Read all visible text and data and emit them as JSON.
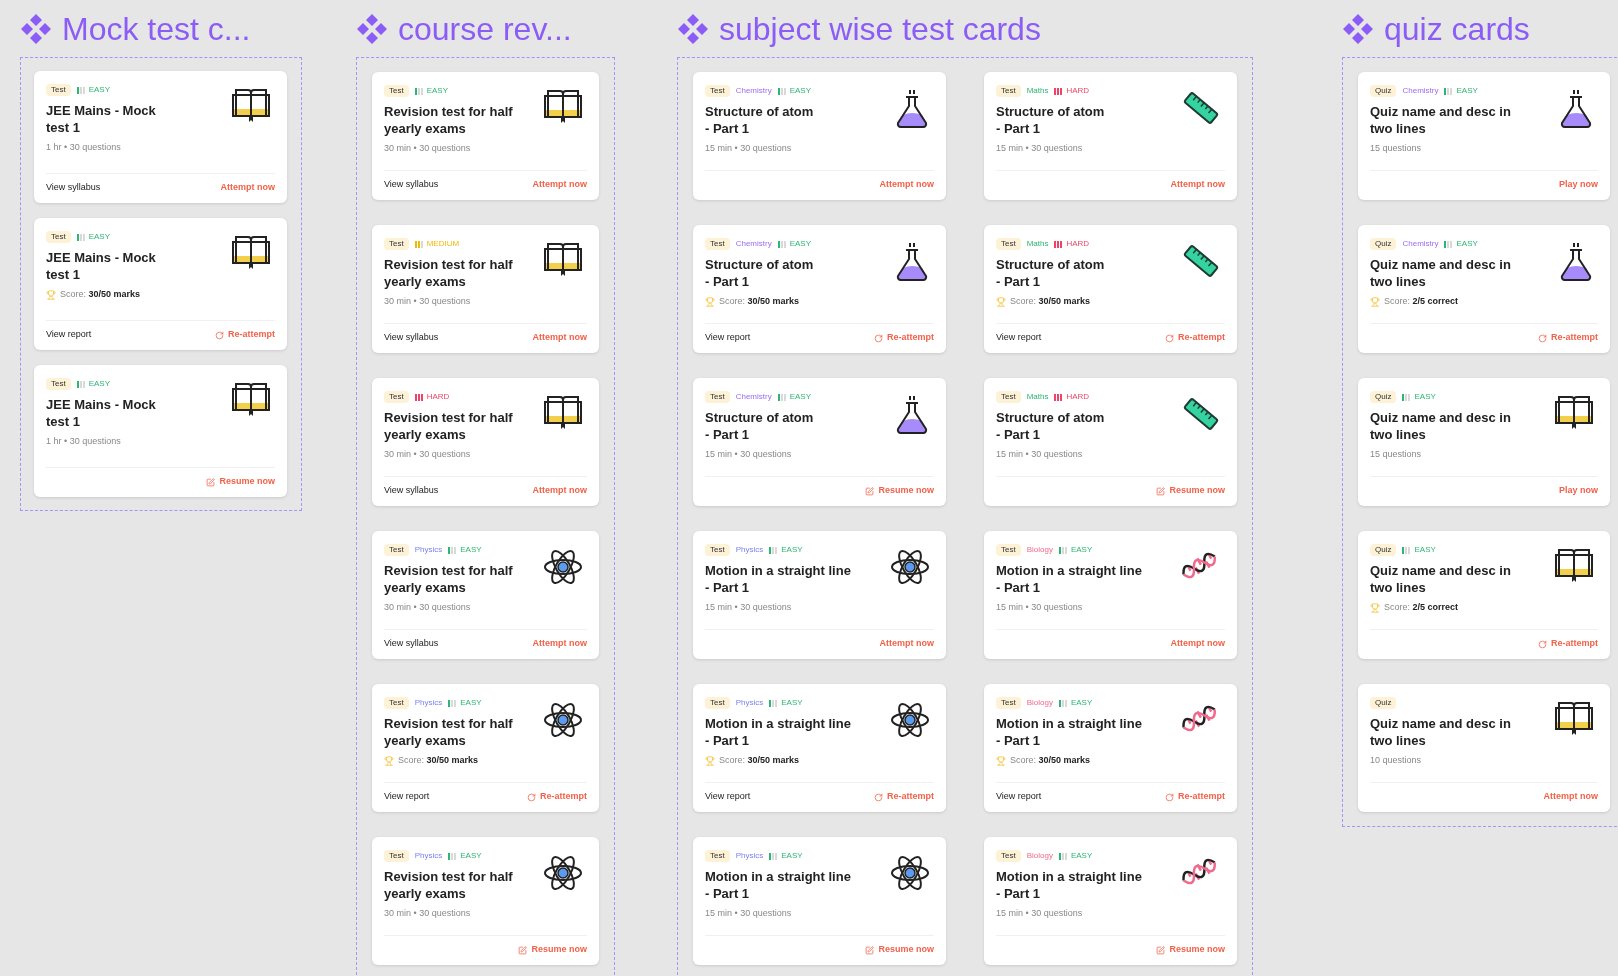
{
  "sections": [
    {
      "title": "Mock test c...",
      "columns": [
        [
          {
            "type": "Test",
            "difficulty": {
              "kind": "easy",
              "label": "EASY"
            },
            "title": "JEE Mains - Mock\ntest 1",
            "meta": {
              "kind": "info",
              "text": "1 hr • 30 questions"
            },
            "link": "View syllabus",
            "action": {
              "kind": "attempt",
              "text": "Attempt now"
            }
          },
          {
            "type": "Test",
            "difficulty": {
              "kind": "easy",
              "label": "EASY"
            },
            "title": "JEE Mains - Mock\ntest 1",
            "meta": {
              "kind": "score",
              "text": "Score: **30/50 marks**"
            },
            "link": "View report",
            "action": {
              "kind": "reattempt",
              "text": "Re-attempt"
            }
          },
          {
            "type": "Test",
            "difficulty": {
              "kind": "easy",
              "label": "EASY"
            },
            "title": "JEE Mains - Mock\ntest 1",
            "meta": {
              "kind": "info",
              "text": "1 hr • 30 questions"
            },
            "action": {
              "kind": "resume",
              "text": "Resume now"
            }
          }
        ]
      ]
    },
    {
      "title": "course rev...",
      "columns": [
        [
          {
            "type": "Test",
            "difficulty": {
              "kind": "easy",
              "label": "EASY"
            },
            "title": "Revision test for half\nyearly exams",
            "meta": {
              "kind": "info",
              "text": "30 min • 30 questions"
            },
            "link": "View syllabus",
            "action": {
              "kind": "attempt",
              "text": "Attempt now"
            }
          },
          {
            "type": "Test",
            "difficulty": {
              "kind": "medium",
              "label": "MEDIUM"
            },
            "title": "Revision test for half\nyearly exams",
            "meta": {
              "kind": "info",
              "text": "30 min • 30 questions"
            },
            "link": "View syllabus",
            "action": {
              "kind": "attempt",
              "text": "Attempt now"
            }
          },
          {
            "type": "Test",
            "difficulty": {
              "kind": "hard",
              "label": "HARD"
            },
            "title": "Revision test for half\nyearly exams",
            "meta": {
              "kind": "info",
              "text": "30 min • 30 questions"
            },
            "link": "View syllabus",
            "action": {
              "kind": "attempt",
              "text": "Attempt now"
            }
          },
          {
            "type": "Test",
            "subject": {
              "name": "Physics",
              "kind": "physics"
            },
            "difficulty": {
              "kind": "easy",
              "label": "EASY"
            },
            "title": "Revision test for half\nyearly exams",
            "meta": {
              "kind": "info",
              "text": "30 min • 30 questions"
            },
            "link": "View syllabus",
            "action": {
              "kind": "attempt",
              "text": "Attempt now"
            }
          },
          {
            "type": "Test",
            "subject": {
              "name": "Physics",
              "kind": "physics"
            },
            "difficulty": {
              "kind": "easy",
              "label": "EASY"
            },
            "title": "Revision test for half\nyearly exams",
            "meta": {
              "kind": "score",
              "text": "Score: **30/50 marks**"
            },
            "link": "View report",
            "action": {
              "kind": "reattempt",
              "text": "Re-attempt"
            }
          },
          {
            "type": "Test",
            "subject": {
              "name": "Physics",
              "kind": "physics"
            },
            "difficulty": {
              "kind": "easy",
              "label": "EASY"
            },
            "title": "Revision test for half\nyearly exams",
            "meta": {
              "kind": "info",
              "text": "30 min • 30 questions"
            },
            "action": {
              "kind": "resume",
              "text": "Resume now"
            }
          }
        ]
      ]
    },
    {
      "title": "subject wise test cards",
      "columns": [
        [
          {
            "type": "Test",
            "subject": {
              "name": "Chemistry",
              "kind": "chemistry"
            },
            "difficulty": {
              "kind": "easy",
              "label": "EASY"
            },
            "title": "Structure of atom\n- Part 1",
            "meta": {
              "kind": "info",
              "text": "15 min • 30 questions"
            },
            "action": {
              "kind": "attempt",
              "text": "Attempt now"
            }
          },
          {
            "type": "Test",
            "subject": {
              "name": "Chemistry",
              "kind": "chemistry"
            },
            "difficulty": {
              "kind": "easy",
              "label": "EASY"
            },
            "title": "Structure of atom\n- Part 1",
            "meta": {
              "kind": "score",
              "text": "Score: **30/50 marks**"
            },
            "link": "View report",
            "action": {
              "kind": "reattempt",
              "text": "Re-attempt"
            }
          },
          {
            "type": "Test",
            "subject": {
              "name": "Chemistry",
              "kind": "chemistry"
            },
            "difficulty": {
              "kind": "easy",
              "label": "EASY"
            },
            "title": "Structure of atom\n- Part 1",
            "meta": {
              "kind": "info",
              "text": "15 min • 30 questions"
            },
            "action": {
              "kind": "resume",
              "text": "Resume now"
            }
          },
          {
            "type": "Test",
            "subject": {
              "name": "Physics",
              "kind": "physics"
            },
            "difficulty": {
              "kind": "easy",
              "label": "EASY"
            },
            "title": "Motion in a straight line\n- Part 1",
            "meta": {
              "kind": "info",
              "text": "15 min • 30 questions"
            },
            "action": {
              "kind": "attempt",
              "text": "Attempt now"
            }
          },
          {
            "type": "Test",
            "subject": {
              "name": "Physics",
              "kind": "physics"
            },
            "difficulty": {
              "kind": "easy",
              "label": "EASY"
            },
            "title": "Motion in a straight line\n- Part 1",
            "meta": {
              "kind": "score",
              "text": "Score: **30/50 marks**"
            },
            "link": "View report",
            "action": {
              "kind": "reattempt",
              "text": "Re-attempt"
            }
          },
          {
            "type": "Test",
            "subject": {
              "name": "Physics",
              "kind": "physics"
            },
            "difficulty": {
              "kind": "easy",
              "label": "EASY"
            },
            "title": "Motion in a straight line\n- Part 1",
            "meta": {
              "kind": "info",
              "text": "15 min • 30 questions"
            },
            "action": {
              "kind": "resume",
              "text": "Resume now"
            }
          }
        ],
        [
          {
            "type": "Test",
            "subject": {
              "name": "Maths",
              "kind": "maths"
            },
            "difficulty": {
              "kind": "hard",
              "label": "HARD"
            },
            "title": "Structure of atom\n- Part 1",
            "meta": {
              "kind": "info",
              "text": "15 min • 30 questions"
            },
            "action": {
              "kind": "attempt",
              "text": "Attempt now"
            }
          },
          {
            "type": "Test",
            "subject": {
              "name": "Maths",
              "kind": "maths"
            },
            "difficulty": {
              "kind": "hard",
              "label": "HARD"
            },
            "title": "Structure of atom\n- Part 1",
            "meta": {
              "kind": "score",
              "text": "Score: **30/50 marks**"
            },
            "link": "View report",
            "action": {
              "kind": "reattempt",
              "text": "Re-attempt"
            }
          },
          {
            "type": "Test",
            "subject": {
              "name": "Maths",
              "kind": "maths"
            },
            "difficulty": {
              "kind": "hard",
              "label": "HARD"
            },
            "title": "Structure of atom\n- Part 1",
            "meta": {
              "kind": "info",
              "text": "15 min • 30 questions"
            },
            "action": {
              "kind": "resume",
              "text": "Resume now"
            }
          },
          {
            "type": "Test",
            "subject": {
              "name": "Biology",
              "kind": "biology"
            },
            "difficulty": {
              "kind": "easy",
              "label": "EASY"
            },
            "title": "Motion in a straight line\n- Part 1",
            "meta": {
              "kind": "info",
              "text": "15 min • 30 questions"
            },
            "action": {
              "kind": "attempt",
              "text": "Attempt now"
            }
          },
          {
            "type": "Test",
            "subject": {
              "name": "Biology",
              "kind": "biology"
            },
            "difficulty": {
              "kind": "easy",
              "label": "EASY"
            },
            "title": "Motion in a straight line\n- Part 1",
            "meta": {
              "kind": "score",
              "text": "Score: **30/50 marks**"
            },
            "link": "View report",
            "action": {
              "kind": "reattempt",
              "text": "Re-attempt"
            }
          },
          {
            "type": "Test",
            "subject": {
              "name": "Biology",
              "kind": "biology"
            },
            "difficulty": {
              "kind": "easy",
              "label": "EASY"
            },
            "title": "Motion in a straight line\n- Part 1",
            "meta": {
              "kind": "info",
              "text": "15 min • 30 questions"
            },
            "action": {
              "kind": "resume",
              "text": "Resume now"
            }
          }
        ]
      ]
    },
    {
      "title": "quiz cards",
      "columns": [
        [
          {
            "type": "Quiz",
            "subject": {
              "name": "Chemistry",
              "kind": "chemistry"
            },
            "difficulty": {
              "kind": "easy",
              "label": "EASY"
            },
            "title": "Quiz name and desc in\ntwo lines",
            "meta": {
              "kind": "info",
              "text": "15 questions"
            },
            "action": {
              "kind": "play",
              "text": "Play now"
            }
          },
          {
            "type": "Quiz",
            "subject": {
              "name": "Chemistry",
              "kind": "chemistry"
            },
            "difficulty": {
              "kind": "easy",
              "label": "EASY"
            },
            "title": "Quiz name and desc in\ntwo lines",
            "meta": {
              "kind": "score",
              "text": "Score: **2/5 correct**"
            },
            "action": {
              "kind": "reattempt",
              "text": "Re-attempt"
            }
          },
          {
            "type": "Quiz",
            "difficulty": {
              "kind": "easy",
              "label": "EASY"
            },
            "title": "Quiz name and desc in\ntwo lines",
            "meta": {
              "kind": "info",
              "text": "15 questions"
            },
            "action": {
              "kind": "play",
              "text": "Play now"
            }
          },
          {
            "type": "Quiz",
            "difficulty": {
              "kind": "easy",
              "label": "EASY"
            },
            "title": "Quiz name and desc in\ntwo lines",
            "meta": {
              "kind": "score",
              "text": "Score: **2/5 correct**"
            },
            "action": {
              "kind": "reattempt",
              "text": "Re-attempt"
            }
          },
          {
            "type": "Quiz",
            "title": "Quiz name and desc in\ntwo lines",
            "meta": {
              "kind": "info",
              "text": "10 questions"
            },
            "action": {
              "kind": "attempt",
              "text": "Attempt now"
            }
          }
        ]
      ]
    }
  ]
}
